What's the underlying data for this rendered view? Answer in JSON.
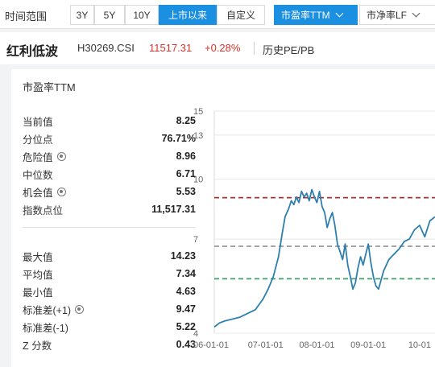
{
  "filter": {
    "label": "时间范围",
    "ranges": [
      {
        "label": "3Y",
        "active": false
      },
      {
        "label": "5Y",
        "active": false
      },
      {
        "label": "10Y",
        "active": false
      },
      {
        "label": "上市以来",
        "active": true
      },
      {
        "label": "自定义",
        "active": false
      }
    ],
    "metric_selected": "市盈率TTM",
    "metric_other": "市净率LF"
  },
  "index": {
    "name": "红利低波",
    "code": "H30269.CSI",
    "value": "11517.31",
    "change": "+0.28%",
    "history_link": "历史PE/PB"
  },
  "stats_panel": {
    "title": "市盈率TTM",
    "group1": [
      {
        "label": "当前值",
        "value": "8.25",
        "gear": false
      },
      {
        "label": "分位点",
        "value": "76.71%",
        "gear": false
      },
      {
        "label": "危险值",
        "value": "8.96",
        "gear": true
      },
      {
        "label": "中位数",
        "value": "6.71",
        "gear": false
      },
      {
        "label": "机会值",
        "value": "5.53",
        "gear": true
      },
      {
        "label": "指数点位",
        "value": "11,517.31",
        "gear": false
      }
    ],
    "group2": [
      {
        "label": "最大值",
        "value": "14.23",
        "gear": false
      },
      {
        "label": "平均值",
        "value": "7.34",
        "gear": false
      },
      {
        "label": "最小值",
        "value": "4.63",
        "gear": false
      },
      {
        "label": "标准差(+1)",
        "value": "9.47",
        "gear": true
      },
      {
        "label": "标准差(-1)",
        "value": "5.22",
        "gear": false
      },
      {
        "label": "Z 分数",
        "value": "0.43",
        "gear": false
      }
    ]
  },
  "chart_data": {
    "type": "line",
    "x_tick_labels": [
      "06-01-01",
      "07-01-01",
      "08-01-01",
      "09-01-01",
      "10-01"
    ],
    "y_tick_labels": [
      "15",
      "13",
      "10",
      "7",
      "4"
    ],
    "ylim": [
      4,
      15
    ],
    "y_scale": "log",
    "grid": "horizontal",
    "series": [
      {
        "color": "#2e7fad",
        "x": [
          2006.0,
          2006.1,
          2006.2,
          2006.35,
          2006.5,
          2006.65,
          2006.8,
          2006.95,
          2007.05,
          2007.15,
          2007.25,
          2007.32,
          2007.38,
          2007.45,
          2007.5,
          2007.55,
          2007.6,
          2007.65,
          2007.7,
          2007.75,
          2007.8,
          2007.85,
          2007.9,
          2007.95,
          2008.0,
          2008.05,
          2008.1,
          2008.15,
          2008.2,
          2008.25,
          2008.3,
          2008.35,
          2008.4,
          2008.45,
          2008.5,
          2008.55,
          2008.6,
          2008.65,
          2008.7,
          2008.75,
          2008.8,
          2008.85,
          2008.9,
          2008.95,
          2009.0,
          2009.05,
          2009.1,
          2009.15,
          2009.2,
          2009.3,
          2009.4,
          2009.5,
          2009.6,
          2009.7,
          2009.8,
          2009.9,
          2010.0,
          2010.1,
          2010.2,
          2010.3
        ],
        "values": [
          4.15,
          4.25,
          4.3,
          4.35,
          4.4,
          4.5,
          4.6,
          4.9,
          5.2,
          5.6,
          6.3,
          7.2,
          8.0,
          8.4,
          8.8,
          8.6,
          9.0,
          8.7,
          9.3,
          9.0,
          9.2,
          8.8,
          9.4,
          9.0,
          8.7,
          9.3,
          8.5,
          8.2,
          7.5,
          7.9,
          8.2,
          7.6,
          6.8,
          6.5,
          6.2,
          6.8,
          6.0,
          5.6,
          5.2,
          5.4,
          5.9,
          6.3,
          6.0,
          6.4,
          6.8,
          6.1,
          5.6,
          5.3,
          5.2,
          5.8,
          6.2,
          6.4,
          6.6,
          6.9,
          7.0,
          7.4,
          7.6,
          7.1,
          7.8,
          8.0
        ]
      }
    ],
    "reference_lines": [
      {
        "name": "危险值",
        "value": 8.96,
        "color": "#a83232"
      },
      {
        "name": "中位数",
        "value": 6.71,
        "color": "#999999"
      },
      {
        "name": "机会值",
        "value": 5.53,
        "color": "#3aa06e"
      }
    ]
  }
}
